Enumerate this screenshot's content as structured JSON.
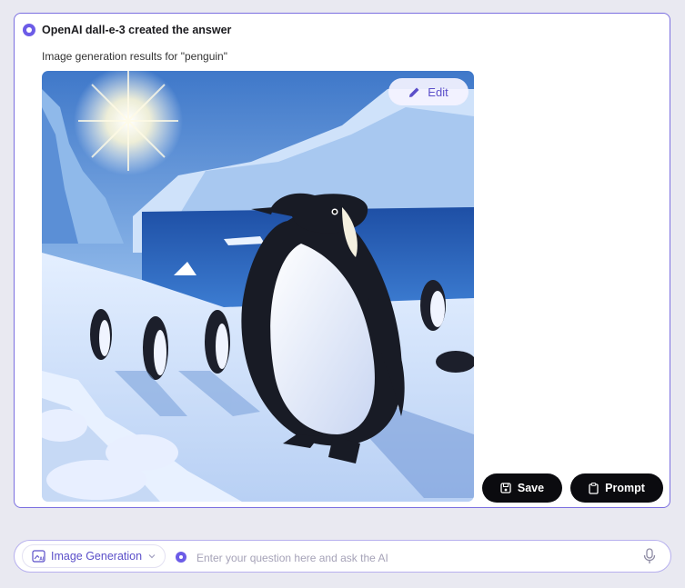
{
  "answer": {
    "header_title": "OpenAI dall-e-3 created the answer",
    "subtitle": "Image generation results for \"penguin\"",
    "edit_label": "Edit",
    "save_label": "Save",
    "prompt_label": "Prompt"
  },
  "input_bar": {
    "mode_label": "Image Generation",
    "placeholder": "Enter your question here and ask the AI",
    "value": ""
  },
  "icons": {
    "header": "radio-dot-icon",
    "edit": "pencil-icon",
    "save": "save-icon",
    "prompt": "clipboard-icon",
    "mode": "image-ai-icon",
    "dropdown": "chevron-down-icon",
    "mic": "microphone-icon"
  },
  "colors": {
    "accent": "#6c5ce7",
    "border": "#7b6fe0",
    "button_dark": "#0b0b0f",
    "background": "#e9e9f1"
  }
}
